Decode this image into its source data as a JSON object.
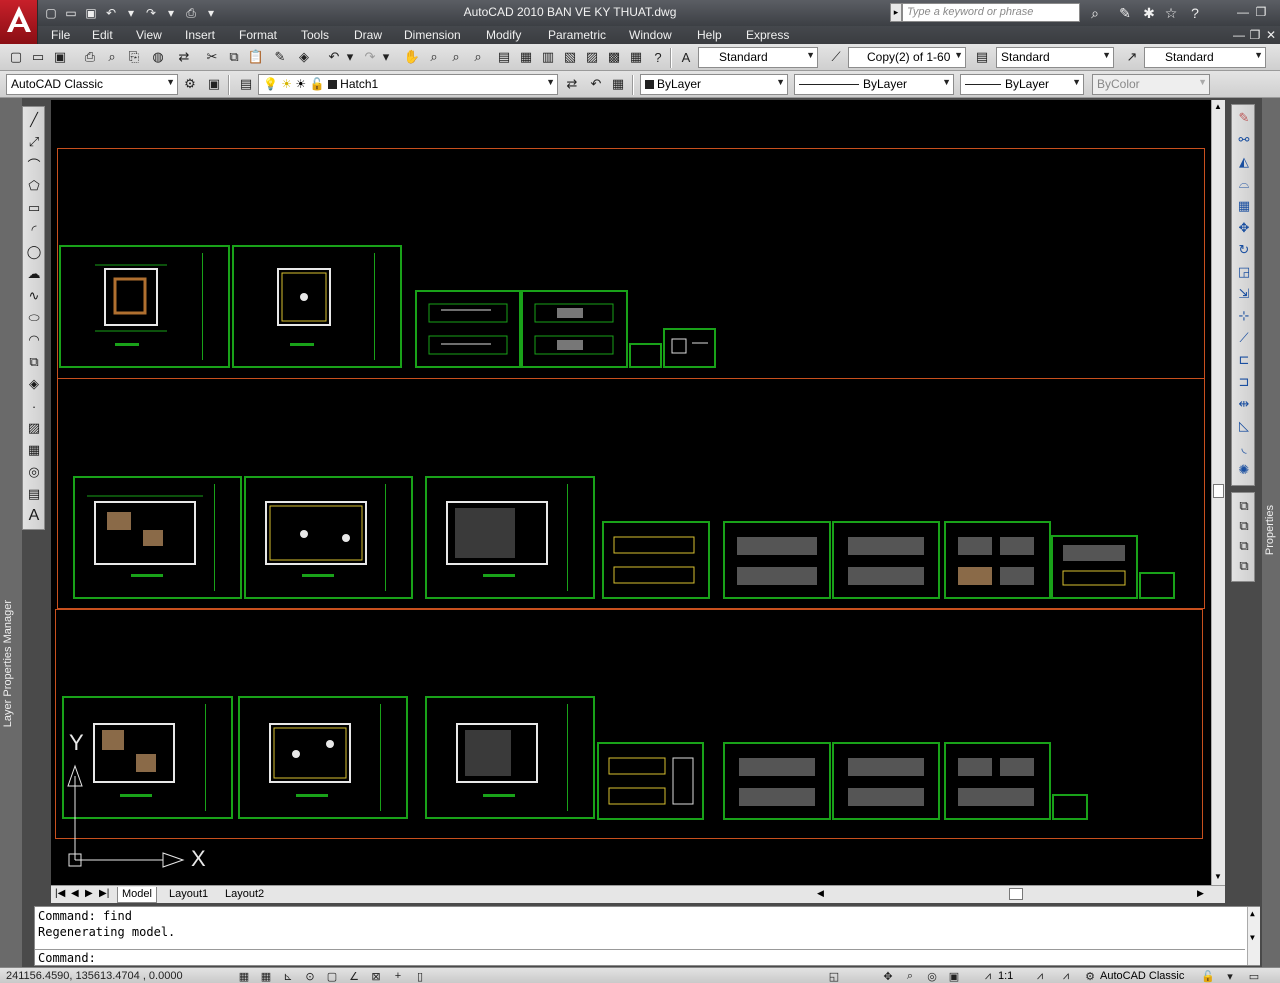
{
  "title_bar": {
    "title": "AutoCAD 2010     BAN VE KY THUAT.dwg",
    "search_placeholder": "Type a keyword or phrase"
  },
  "menu": [
    "File",
    "Edit",
    "View",
    "Insert",
    "Format",
    "Tools",
    "Draw",
    "Dimension",
    "Modify",
    "Parametric",
    "Window",
    "Help",
    "Express"
  ],
  "toolbar1": {
    "text_style": "Standard",
    "copy_combo": "Copy(2) of 1-60",
    "table_style": "Standard",
    "multileader_style": "Standard"
  },
  "toolbar2": {
    "workspace": "AutoCAD Classic",
    "layer": "Hatch1",
    "color": "ByLayer",
    "linetype": "ByLayer",
    "lineweight": "ByLayer",
    "plot_style": "ByColor"
  },
  "palettes": {
    "left_label": "Layer Properties Manager",
    "right_label": "Properties"
  },
  "ucs": {
    "y_label": "Y",
    "x_label": "X"
  },
  "tabs": [
    "Model",
    "Layout1",
    "Layout2"
  ],
  "active_tab": "Model",
  "command_history": [
    "Command: find",
    "Regenerating model."
  ],
  "command_prompt": "Command:",
  "status": {
    "coordinates": "241156.4590, 135613.4704 , 0.0000",
    "annotation_scale": "1:1",
    "workspace": "AutoCAD Classic"
  },
  "colors": {
    "canvas": "#000000",
    "sheet_border": "#19a219",
    "frame_border": "#c8501e"
  }
}
